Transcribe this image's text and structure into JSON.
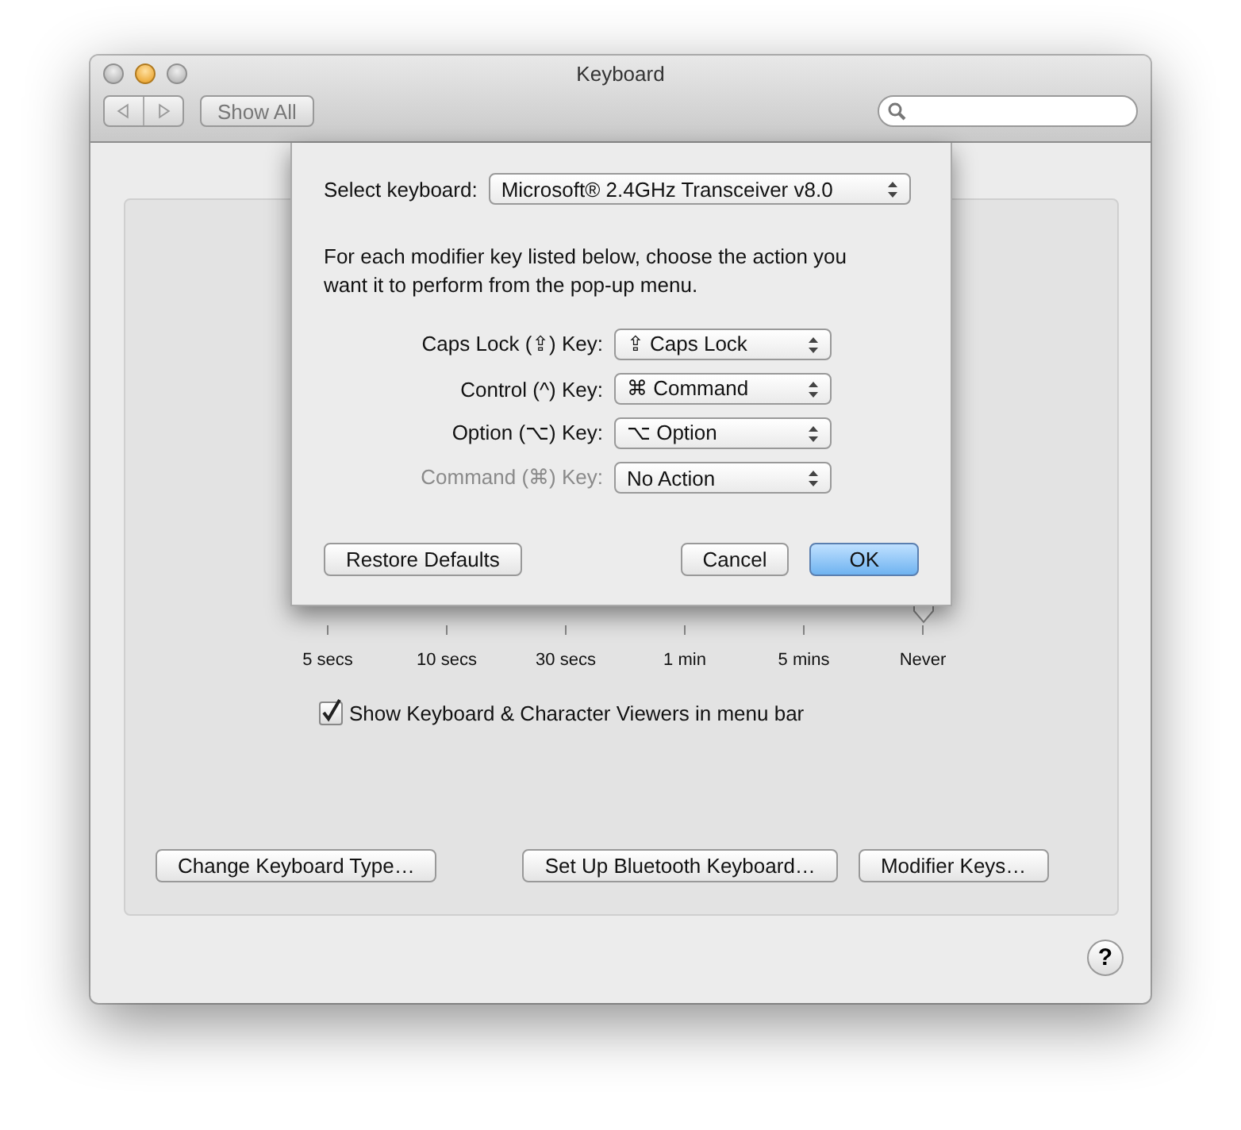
{
  "window": {
    "title": "Keyboard"
  },
  "toolbar": {
    "show_all": "Show All"
  },
  "panel": {
    "slider": {
      "ticks": [
        "5 secs",
        "10 secs",
        "30 secs",
        "1 min",
        "5 mins",
        "Never"
      ]
    },
    "checkbox": {
      "label": "Show Keyboard & Character Viewers in menu bar",
      "checked": true
    },
    "buttons": [
      "Change Keyboard Type…",
      "Set Up Bluetooth Keyboard…",
      "Modifier Keys…"
    ]
  },
  "help": "?",
  "sheet": {
    "select_label": "Select keyboard:",
    "select_value": "Microsoft® 2.4GHz Transceiver v8.0",
    "description": "For each modifier key listed below, choose the action you want it to perform from the pop-up menu.",
    "rows": [
      {
        "label": "Caps Lock (⇪) Key:",
        "value": "⇪ Caps Lock",
        "disabled": false
      },
      {
        "label": "Control (^) Key:",
        "value": "⌘ Command",
        "disabled": false
      },
      {
        "label": "Option (⌥) Key:",
        "value": "⌥ Option",
        "disabled": false
      },
      {
        "label": "Command (⌘) Key:",
        "value": "No Action",
        "disabled": true
      }
    ],
    "buttons": [
      {
        "label": "Restore Defaults",
        "default": false
      },
      {
        "label": "Cancel",
        "default": false
      },
      {
        "label": "OK",
        "default": true
      }
    ]
  }
}
